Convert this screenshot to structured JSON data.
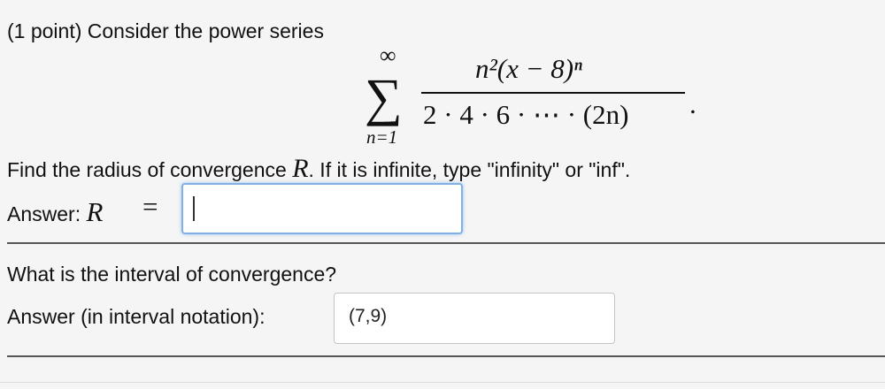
{
  "problem": {
    "intro": "(1 point) Consider the power series",
    "series": {
      "upper_limit": "∞",
      "sigma": "∑",
      "lower_limit": "n=1",
      "numerator": "n²(x − 8)ⁿ",
      "denominator": "2 · 4 · 6 · ⋯ · (2n)",
      "terminator": "."
    },
    "instruction_before": "Find the radius of convergence ",
    "instruction_var": "R",
    "instruction_after": ". If it is infinite, type \"infinity\" or \"inf\"."
  },
  "answer1": {
    "label": "Answer: ",
    "var": "R",
    "equals": "=",
    "value": ""
  },
  "question2": {
    "text": "What is the interval of convergence?",
    "label": "Answer (in interval notation):",
    "value": "(7,9)"
  },
  "colors": {
    "focus_border": "#7fb1e6",
    "input_border": "#c4c4c4",
    "background": "#f5f5f5"
  }
}
